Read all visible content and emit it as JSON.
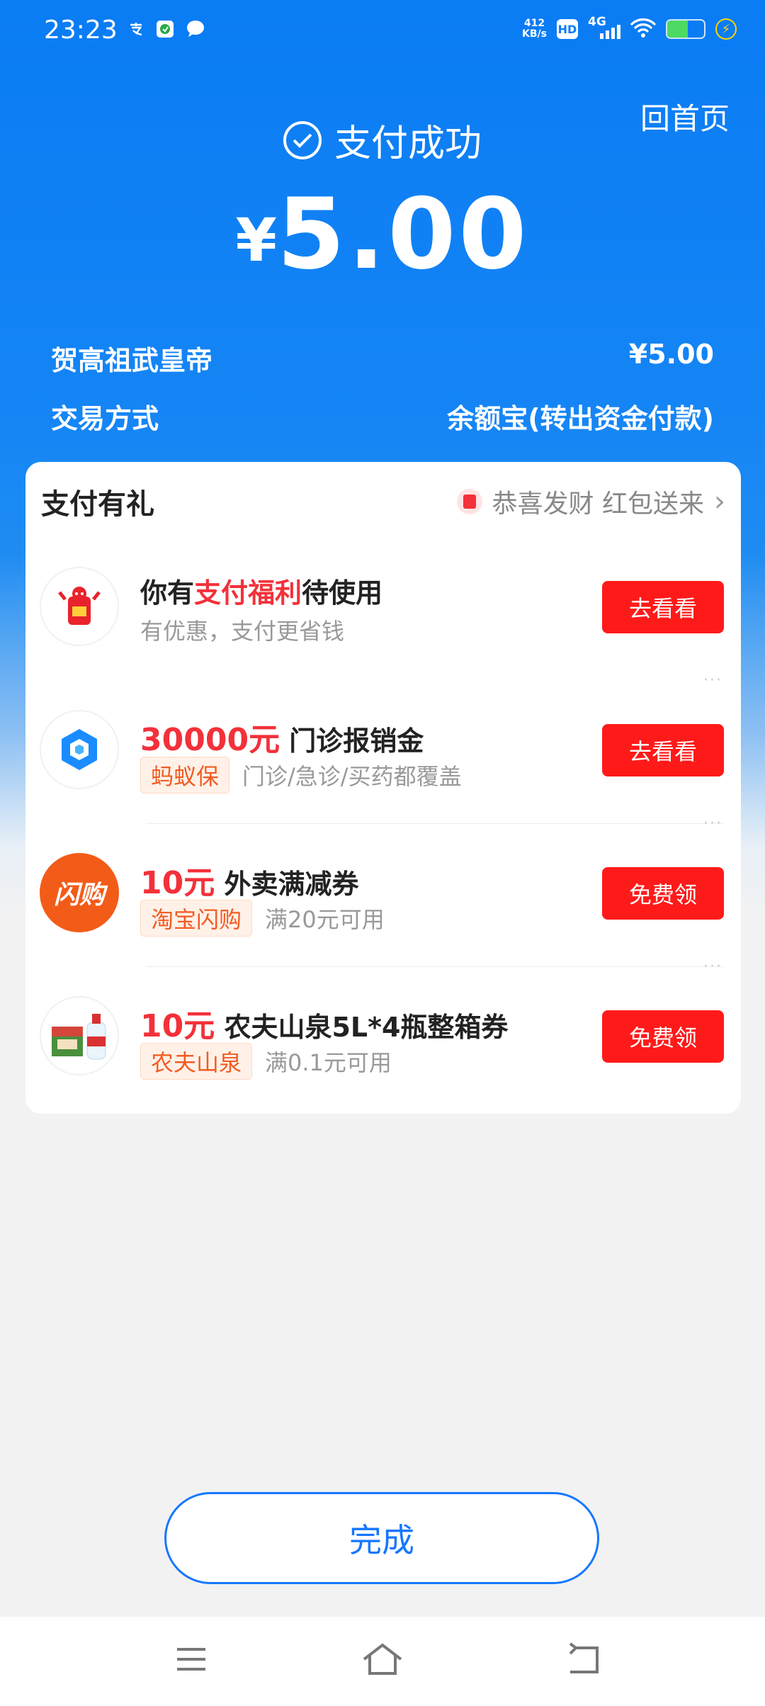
{
  "status_bar": {
    "time": "23:23",
    "net_speed_value": "412",
    "net_speed_unit": "KB/s",
    "hd_label": "HD",
    "network_type": "4G",
    "battery_level": 0.55,
    "left_icons": [
      "alipay-icon",
      "app-icon",
      "chat-bubble-icon"
    ]
  },
  "header": {
    "home_link": "回首页",
    "status_title": "支付成功",
    "currency_symbol": "¥",
    "amount": "5.00"
  },
  "details": [
    {
      "label": "贺高祖武皇帝",
      "value": "¥5.00"
    },
    {
      "label": "交易方式",
      "value": "余额宝(转出资金付款)"
    }
  ],
  "gift_card": {
    "title": "支付有礼",
    "promo_text": "恭喜发财 红包送来",
    "items": [
      {
        "headline_prefix": "你有",
        "headline_highlight": "支付福利",
        "headline_suffix": "待使用",
        "subtitle": "有优惠，支付更省钱",
        "button": "去看看"
      },
      {
        "headline_highlight": "30000元",
        "headline_suffix": " 门诊报销金",
        "tag": "蚂蚁保",
        "subtitle": "门诊/急诊/买药都覆盖",
        "button": "去看看"
      },
      {
        "headline_highlight": "10元",
        "headline_suffix": " 外卖满减券",
        "tag": "淘宝闪购",
        "subtitle": "满20元可用",
        "button": "免费领",
        "logo_text": "闪购"
      },
      {
        "headline_highlight": "10元",
        "headline_suffix": " 农夫山泉5L*4瓶整箱券",
        "tag": "农夫山泉",
        "subtitle": "满0.1元可用",
        "button": "免费领"
      }
    ],
    "more_glyph": "···"
  },
  "done_button": "完成",
  "colors": {
    "brand_blue": "#0a7cf4",
    "action_red": "#ff1a1a",
    "tag_orange": "#f25c22"
  }
}
